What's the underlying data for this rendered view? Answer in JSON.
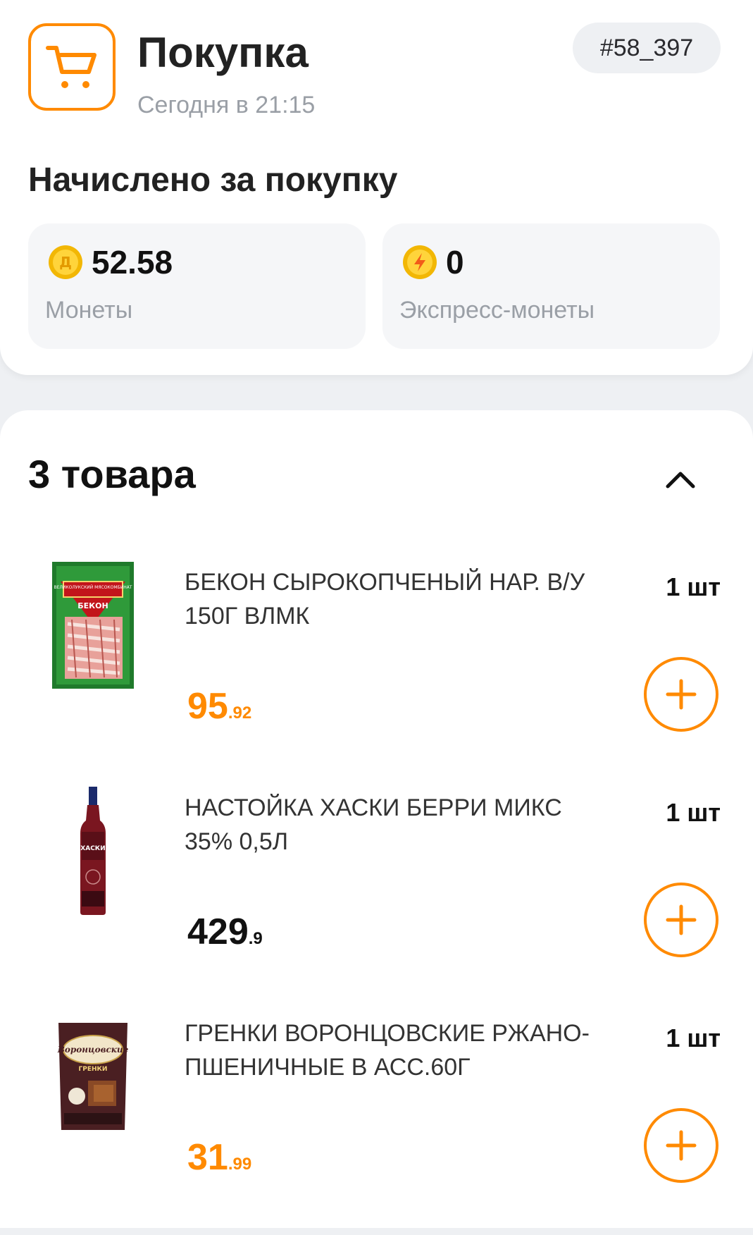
{
  "header": {
    "title": "Покупка",
    "subtitle": "Сегодня в 21:15",
    "order_number": "#58_397",
    "accent_color": "#ff8a00"
  },
  "accrued": {
    "title": "Начислено за покупку",
    "coins": {
      "value": "52.58",
      "label": "Монеты",
      "icon": "coin-icon"
    },
    "express": {
      "value": "0",
      "label": "Экспресс-монеты",
      "icon": "lightning-coin-icon"
    }
  },
  "items": {
    "title": "3 товара",
    "toggle_icon": "chevron-up-icon",
    "list": [
      {
        "name": "БЕКОН СЫРОКОПЧЕНЫЙ НАР. В/У 150Г ВЛМК",
        "qty": "1 шт",
        "price_int": "95",
        "price_dec": ".92",
        "price_color": "orange",
        "image": "bacon-pack-image"
      },
      {
        "name": "НАСТОЙКА ХАСКИ БЕРРИ МИКС 35% 0,5Л",
        "qty": "1 шт",
        "price_int": "429",
        "price_dec": ".9",
        "price_color": "black",
        "image": "bottle-image"
      },
      {
        "name": "ГРЕНКИ ВОРОНЦОВСКИЕ РЖАНО-ПШЕНИЧНЫЕ В АСС.60Г",
        "qty": "1 шт",
        "price_int": "31",
        "price_dec": ".99",
        "price_color": "orange",
        "image": "croutons-pack-image"
      }
    ]
  },
  "images": {
    "bacon_brand": "ВЕЛИКОЛУКСКИЙ МЯСОКОМБИНАТ",
    "bacon_label": "БЕКОН",
    "bottle_brand": "ХАСКИ",
    "croutons_brand": "Воронцовские",
    "croutons_label": "ГРЕНКИ"
  }
}
